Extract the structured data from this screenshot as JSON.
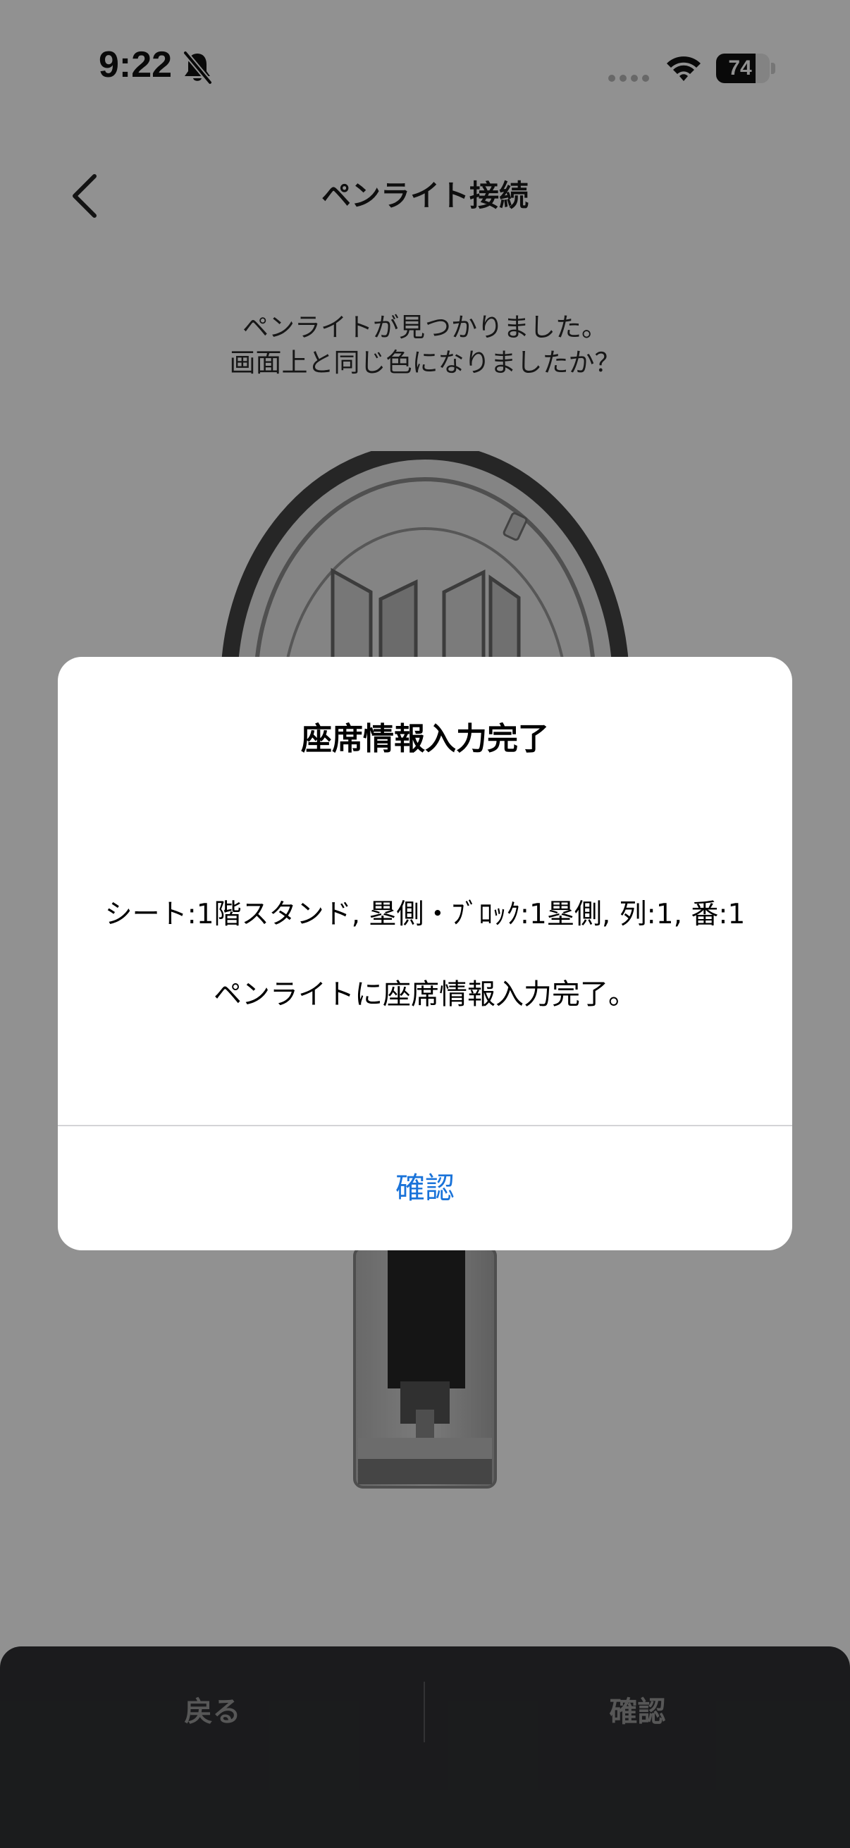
{
  "status_bar": {
    "time": "9:22",
    "battery": "74",
    "battery_level": 0.74
  },
  "header": {
    "title": "ペンライト接続"
  },
  "instruction": {
    "line1": "ペンライトが見つかりました。",
    "line2": "画面上と同じ色になりましたか？"
  },
  "bottom_bar": {
    "back_label": "戻る",
    "confirm_label": "確認"
  },
  "dialog": {
    "title": "座席情報入力完了",
    "seat_info": "シート:1階スタンド, 塁側・ﾌﾞﾛｯｸ:1塁側, 列:1, 番:1",
    "message": "ペンライトに座席情報入力完了。",
    "confirm_label": "確認"
  },
  "colors": {
    "accent": "#1a73d9",
    "bottom_bar": "#303133",
    "overlay": "rgba(0,0,0,0.43)"
  },
  "icons": {
    "back": "chevron-left-icon",
    "mute": "bell-slash-icon",
    "wifi": "wifi-icon",
    "battery": "battery-icon"
  }
}
